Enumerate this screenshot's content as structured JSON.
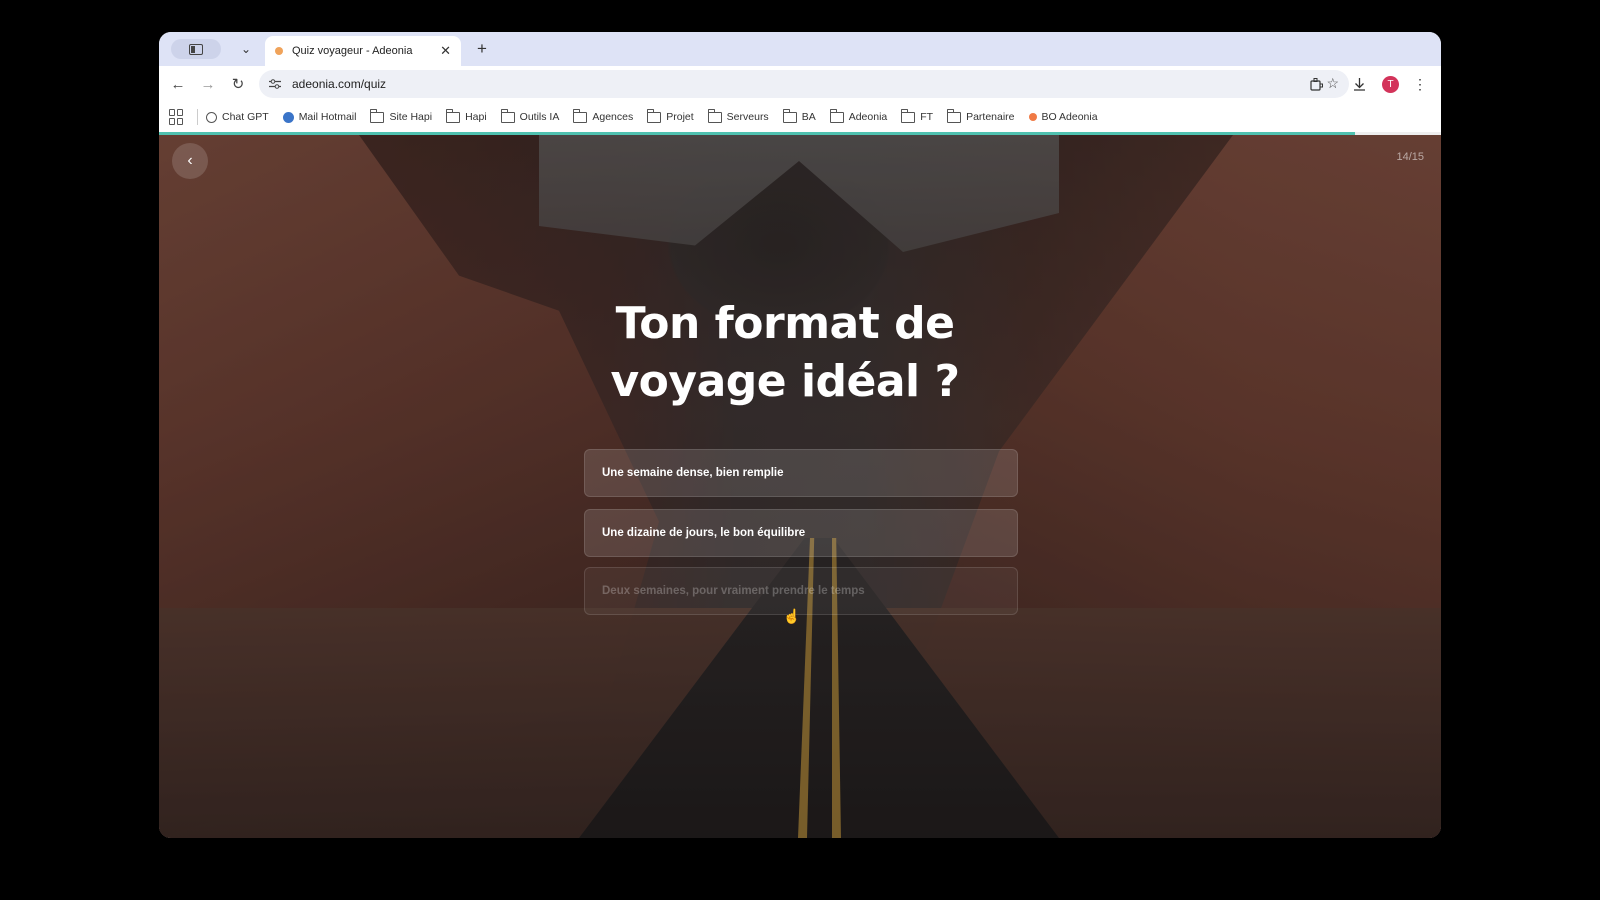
{
  "browser": {
    "tab": {
      "title": "Quiz voyageur - Adeonia",
      "close_glyph": "✕"
    },
    "new_tab_glyph": "+",
    "nav": {
      "back": "←",
      "forward": "→",
      "reload": "↻"
    },
    "url": "adeonia.com/quiz",
    "profile_initial": "T",
    "bookmarks": [
      {
        "label": "Chat GPT",
        "icon": "chatgpt-icon"
      },
      {
        "label": "Mail Hotmail",
        "icon": "mail-icon"
      },
      {
        "label": "Site Hapi",
        "icon": "folder-icon"
      },
      {
        "label": "Hapi",
        "icon": "folder-icon"
      },
      {
        "label": "Outils IA",
        "icon": "folder-icon"
      },
      {
        "label": "Agences",
        "icon": "folder-icon"
      },
      {
        "label": "Projet",
        "icon": "folder-icon"
      },
      {
        "label": "Serveurs",
        "icon": "folder-icon"
      },
      {
        "label": "BA",
        "icon": "folder-icon"
      },
      {
        "label": "Adeonia",
        "icon": "folder-icon"
      },
      {
        "label": "FT",
        "icon": "folder-icon"
      },
      {
        "label": "Partenaire",
        "icon": "folder-icon"
      },
      {
        "label": "BO Adeonia",
        "icon": "adeonia-icon"
      }
    ]
  },
  "quiz": {
    "progress_fraction": 0.933,
    "counter": "14/15",
    "back_glyph": "‹",
    "question_line1": "Ton format de",
    "question_line2": "voyage idéal ?",
    "answers": [
      "Une semaine dense, bien remplie",
      "Une dizaine de jours, le bon équilibre",
      "Deux semaines, pour vraiment prendre le temps"
    ]
  },
  "colors": {
    "accent": "#4fc1b0",
    "avatar": "#d3335a"
  }
}
